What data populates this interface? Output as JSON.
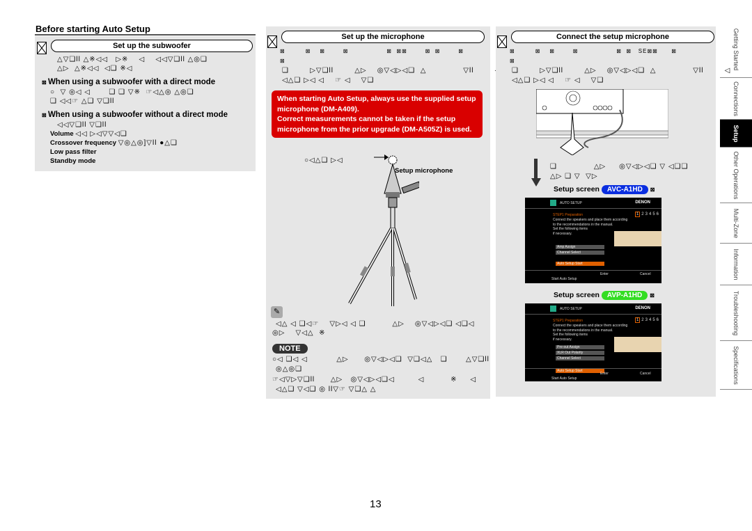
{
  "section_title": "Before starting Auto Setup",
  "subwoofer": {
    "heading": "Set up the subwoofer",
    "intro": [
      "△▽❑ll △※◁◁   ▷※    ◁    ◁◁▽❑ll △◎❑",
      "△▷  △※◁◁  ◁❑ ※◁"
    ],
    "direct_title": "When using a subwoofer with a direct mode",
    "direct_text": [
      "○  ▽ ◎◁ ◁       ❑ ❑ ▽※  ☞◁△◎ △◎❑",
      "❑ ◁◁☞ △❑ ▽❑ll"
    ],
    "nodirect_title": "When using a subwoofer without a direct mode",
    "nodirect_text": "◁◁▽❑ll ▽❑ll",
    "settings": [
      {
        "label": "Volume",
        "value": "◁◁ ▷◁▽▽◁❑"
      },
      {
        "label": "Crossover frequency",
        "value": "▽◎△◎]▽ll ●△❑"
      },
      {
        "label": "Low pass filter",
        "value": ""
      },
      {
        "label": "Standby mode",
        "value": ""
      }
    ]
  },
  "microphone": {
    "heading": "Set up the microphone",
    "lines": [
      "⊠         ⊠    ⊠        ⊠                 ⊠  ⊠⊠        ⊠  ⊠        ⊠",
      "⊠",
      "❑        ▷▽❑ll        △▷    ◎▽◁▷◁❑  △              ▽ll        ◁",
      "◁△❑ ▷◁ ◁    ☞ ◁    ▽❑"
    ],
    "warning": [
      "When starting Auto Setup, always use the supplied setup microphone (DM-A409).",
      "Correct measurements cannot be taken if the setup microphone from the prior upgrade (DM-A505Z) is used."
    ],
    "callout_glyphs": "○◁△❑ ▷◁",
    "mic_label": "Setup microphone",
    "tip_lines": [
      "◁△ ◁ ❑◁☞    ▽▷◁ ◁ ❑          △▷    ◎▽◁▷◁❑ ◁❑◁",
      "◎▷    ▽◁△  ※"
    ],
    "note_label": "NOTE",
    "note_lines": [
      "○◁ ❑◁ ◁           △▷      ◎▽◁▷◁❑  ▽❑◁△   ❑       △▽❑ll",
      "◎△◎❑",
      "☞◁▽▷▽❑ll      △▷   ◎▽◁▷◁❑◁         ◁          ※     ◁",
      "◁△❑ ▽◁❑ ◎ ll▽☞ ▽❑△ △"
    ]
  },
  "connect": {
    "heading": "Connect the setup microphone",
    "lines": [
      "⊠         ⊠    ⊠        ⊠                 ⊠  ⊠   SE⊠⊠      ⊠",
      "⊠",
      "❑        ▷▽❑ll        △▷    ◎▽◁▷◁❑  △              ▽ll        ◁",
      "◁△❑ ▷◁ ◁    ☞ ◁    ▽❑"
    ],
    "after_lines": [
      "❑              △▷     ◎▽◁▷◁❑ ▽ ◁❑❑",
      "△▷ ❑ ▽  ▽▷"
    ],
    "screens": [
      {
        "label": "Setup screen",
        "model": "AVC-A1HD",
        "model_color": "#0a2ee0",
        "title": "AUTO SETUP",
        "brand": "DENON",
        "step": "STEP1 Preparation",
        "steps": [
          "1",
          "2",
          "3",
          "4",
          "5",
          "6"
        ],
        "desc": [
          "Connect the speakers and place them according",
          "to the recommendations in the manual.",
          "Set the following items",
          "if necessary."
        ],
        "menu": [
          "Amp Assign",
          "Channel Select"
        ],
        "start": "Auto Setup Start",
        "enter": "Enter",
        "cancel": "Cancel",
        "footer": "Start Auto Setup"
      },
      {
        "label": "Setup screen",
        "model": "AVP-A1HD",
        "model_color": "#33dd22",
        "title": "AUTO SETUP",
        "brand": "DENON",
        "step": "STEP1 Preparation",
        "steps": [
          "1",
          "2",
          "3",
          "4",
          "5",
          "6"
        ],
        "desc": [
          "Connect the speakers and place them according",
          "to the recommendations in the manual.",
          "Set the following items",
          "if necessary."
        ],
        "menu": [
          "Pre-out Assign",
          "XLR Out Polarity",
          "Channel Select"
        ],
        "start": "Auto Setup Start",
        "enter": "Enter",
        "cancel": "Cancel",
        "footer": "Start Auto Setup"
      }
    ]
  },
  "side_tabs": [
    "Getting Started",
    "Connections",
    "Setup",
    "Other Operations",
    "Multi-Zone",
    "Information",
    "Troubleshooting",
    "Specifications"
  ],
  "active_tab": "Setup",
  "page_number": "13"
}
